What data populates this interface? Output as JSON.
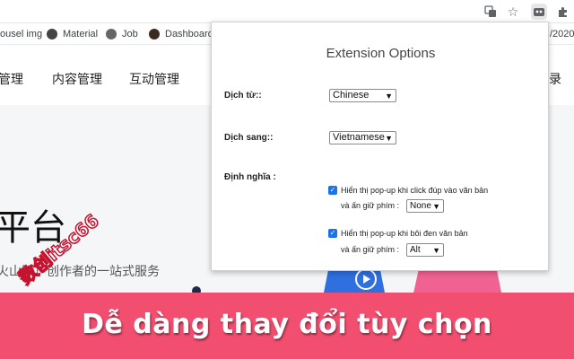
{
  "browser": {
    "url_fragment": "/2020",
    "icons": [
      "translate-icon",
      "star-icon",
      "extension-active-icon",
      "puzzle-icon"
    ]
  },
  "bookmarks": [
    {
      "label": "ousel img"
    },
    {
      "label": "Material"
    },
    {
      "label": "Job"
    },
    {
      "label": "DashboardPa"
    }
  ],
  "page": {
    "nav": [
      "管理",
      "内容管理",
      "互动管理",
      "录"
    ],
    "hero_title": "平台",
    "hero_subtitle": "火山版）创作者的一站式服务"
  },
  "popup": {
    "title": "Extension Options",
    "from_label": "Dịch từ::",
    "from_value": "Chinese",
    "to_label": "Dịch sang::",
    "to_value": "Vietnamese",
    "define_label": "Định nghĩa :",
    "option1_line1": "Hiển thị pop-up khi click đúp vào văn bản",
    "option1_line2": "và ấn giữ phím :",
    "option1_key": "None",
    "option1_checked": true,
    "option2_line1": "Hiển thị pop-up khi bôi đen văn bản",
    "option2_line2": "và ấn giữ phím :",
    "option2_key": "Alt",
    "option2_checked": true
  },
  "banner": {
    "text": "Dễ dàng thay đổi tùy chọn",
    "watermark": "数创itsc66"
  },
  "colors": {
    "banner": "#f24e6f",
    "checkbox": "#1a73e8"
  }
}
